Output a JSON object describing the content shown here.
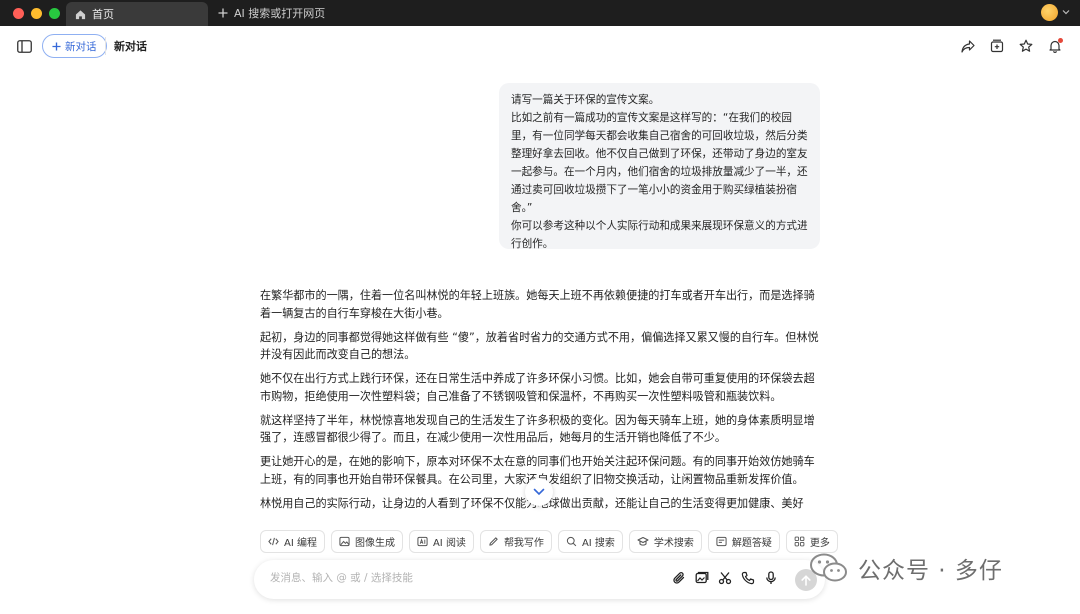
{
  "titlebar": {
    "tab_home_label": "首页",
    "new_tab_label": "AI 搜索或打开网页",
    "traffic_colors": [
      "#ff5f57",
      "#febc2e",
      "#28c840"
    ]
  },
  "toolbar": {
    "new_chat_label": "新对话",
    "conversation_title": "新对话"
  },
  "user_message": [
    "请写一篇关于环保的宣传文案。",
    "比如之前有一篇成功的宣传文案是这样写的：“在我们的校园里，有一位同学每天都会收集自己宿舍的可回收垃圾，然后分类整理好拿去回收。他不仅自己做到了环保，还带动了身边的室友一起参与。在一个月内，他们宿舍的垃圾排放量减少了一半，还通过卖可回收垃圾攒下了一笔小小的资金用于购买绿植装扮宿舍。”",
    "你可以参考这种以个人实际行动和成果来展现环保意义的方式进行创作。"
  ],
  "answer": [
    "在繁华都市的一隅，住着一位名叫林悦的年轻上班族。她每天上班不再依赖便捷的打车或者开车出行，而是选择骑着一辆复古的自行车穿梭在大街小巷。",
    "起初，身边的同事都觉得她这样做有些 “傻”，放着省时省力的交通方式不用，偏偏选择又累又慢的自行车。但林悦并没有因此而改变自己的想法。",
    "她不仅在出行方式上践行环保，还在日常生活中养成了许多环保小习惯。比如，她会自带可重复使用的环保袋去超市购物，拒绝使用一次性塑料袋；自己准备了不锈钢吸管和保温杯，不再购买一次性塑料吸管和瓶装饮料。",
    "就这样坚持了半年，林悦惊喜地发现自己的生活发生了许多积极的变化。因为每天骑车上班，她的身体素质明显增强了，连感冒都很少得了。而且，在减少使用一次性用品后，她每月的生活开销也降低了不少。",
    "更让她开心的是，在她的影响下，原本对环保不太在意的同事们也开始关注起环保问题。有的同事开始效仿她骑车上班，有的同事也开始自带环保餐具。在公司里，大家还自发组织了旧物交换活动，让闲置物品重新发挥价值。",
    "林悦用自己的实际行动，让身边的人看到了环保不仅能为地球做出贡献，还能让自己的生活变得更加健康、美好"
  ],
  "skills": [
    {
      "label": "AI 编程",
      "icon": "code-icon"
    },
    {
      "label": "图像生成",
      "icon": "image-icon"
    },
    {
      "label": "AI 阅读",
      "icon": "read-icon"
    },
    {
      "label": "帮我写作",
      "icon": "pen-icon"
    },
    {
      "label": "AI 搜索",
      "icon": "search-icon"
    },
    {
      "label": "学术搜索",
      "icon": "graduation-cap-icon"
    },
    {
      "label": "解题答疑",
      "icon": "solve-icon"
    },
    {
      "label": "更多",
      "icon": "grid-icon"
    }
  ],
  "input": {
    "placeholder": "发消息、输入 @ 或 / 选择技能",
    "value": ""
  },
  "watermark": {
    "text": "公众号 · 多仔"
  },
  "colors": {
    "accent": "#3568d8",
    "notification": "#e5483a"
  }
}
